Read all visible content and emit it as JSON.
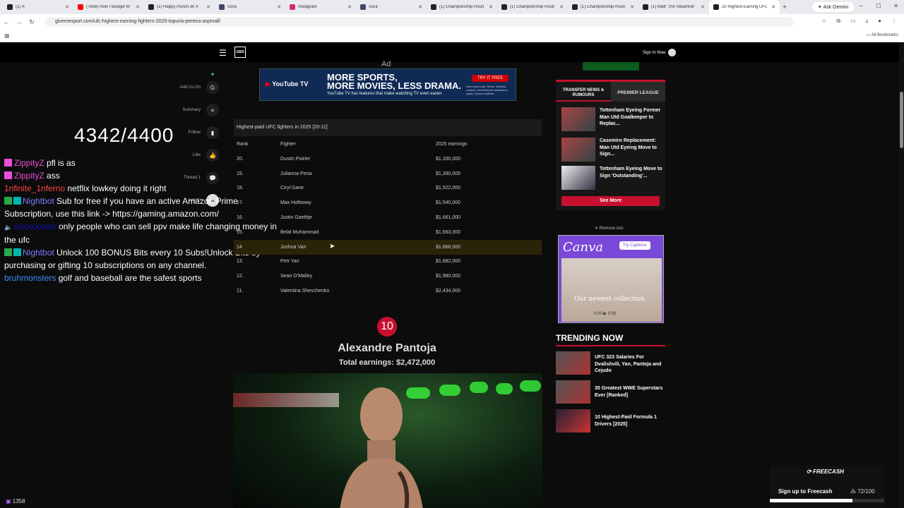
{
  "browser": {
    "tabs": [
      {
        "title": "(1) X"
      },
      {
        "title": "(7608) How I Budget M"
      },
      {
        "title": "(1) Happy Punch on X"
      },
      {
        "title": "Sora"
      },
      {
        "title": "Instagram"
      },
      {
        "title": "Sora"
      },
      {
        "title": "(1) Championship Roun"
      },
      {
        "title": "(1) Championship Roun"
      },
      {
        "title": "(1) Championship Roun"
      },
      {
        "title": "(1) Matt 'The Steamroll"
      },
      {
        "title": "20 Highest-Earning UFC"
      }
    ],
    "new_tab": "+",
    "ask_gemini": "Ask Gemini",
    "url": "givemesport.com/ufc-highest-earning-fighters-2025-topuria-pereira-aspinall/",
    "all_bookmarks": "All Bookmarks"
  },
  "site": {
    "logo": "GMS",
    "sign_in": "Sign In Now"
  },
  "ad_top": {
    "label": "Ad",
    "brand": "YouTube TV",
    "headline1": "MORE SPORTS,",
    "headline2": "MORE MOVIES, LESS DRAMA.",
    "sub": "YouTube TV has features that make watching TV even easier",
    "button": "TRY IT FREE",
    "fine": "New users only. Terms, devices, content, and blackout restrictions apply. Cancel anytime."
  },
  "side_actions": [
    {
      "label": "",
      "icon": "sparkle-icon"
    },
    {
      "label": "Add Us On",
      "icon": "google-icon"
    },
    {
      "label": "Summary",
      "icon": "summary-icon"
    },
    {
      "label": "Follow",
      "icon": "bookmark-icon"
    },
    {
      "label": "Like",
      "icon": "thumbs-up-icon"
    },
    {
      "label": "Thread",
      "count": "1",
      "icon": "thread-icon"
    },
    {
      "label": "Log In",
      "icon": "user-icon"
    }
  ],
  "overlay": {
    "count": "4342/4400",
    "viewers": "1358"
  },
  "chat": [
    {
      "user": "ZippityZ",
      "msg": "pfl is as",
      "color": "#e94fd7"
    },
    {
      "user": "ZippityZ",
      "msg": "ass",
      "color": "#e94fd7"
    },
    {
      "user": "1nfinite_1nferno",
      "msg": "netflix lowkey doing it right",
      "color": "#ff4444"
    },
    {
      "user": "Nightbot",
      "msg": "Sub for free if you have an active Amazon Prime Subscription, use this link -> https://gaming.amazon.com/",
      "color": "#7a7aff"
    },
    {
      "user": "",
      "msg": "only people who can sell ppv make life changing money in the ufc",
      "color": "#1414c8"
    },
    {
      "user": "Nightbot",
      "msg": "Unlock 100 BONUS Bits every 10 Subs!Unlock Bits by purchasing or gifting 10 subscriptions on any channel.",
      "color": "#7a7aff"
    },
    {
      "user": "bruhmonsters",
      "msg": "golf and baseball are the safest sports",
      "color": "#3d8bff"
    }
  ],
  "table": {
    "caption": "Highest-paid UFC fighters in 2025 [20-11]",
    "headers": [
      "Rank",
      "Fighter",
      "2025 earnings"
    ],
    "rows": [
      [
        "20.",
        "Dustin Poirier",
        "$1,330,000"
      ],
      [
        "19.",
        "Julianna Pena",
        "$1,390,000"
      ],
      [
        "18.",
        "Ciryl Gane",
        "$1,522,000"
      ],
      [
        "17.",
        "Max Holloway",
        "$1,540,000"
      ],
      [
        "16.",
        "Justin Gaethje",
        "$1,661,000"
      ],
      [
        "15.",
        "Belal Muhammad",
        "$1,663,000"
      ],
      [
        "14",
        "Joshua Van",
        "$1,668,000"
      ],
      [
        "13.",
        "Petr Yan",
        "$1,682,000"
      ],
      [
        "12.",
        "Sean O'Malley",
        "$1,980,000"
      ],
      [
        "11.",
        "Valentina Shevchenko",
        "$2,434,000"
      ]
    ]
  },
  "feature": {
    "rank": "10",
    "name": "Alexandre Pantoja",
    "earnings": "Total earnings: $2,472,000"
  },
  "transfer_widget": {
    "tab1": "TRANSFER NEWS & RUMOURS",
    "tab2": "PREMIER LEAGUE",
    "items": [
      "Tottenham Eyeing Former Man Utd Goalkeeper to Replac...",
      "Casemiro Replacement: Man Utd Eyeing Move to Sign...",
      "Tottenham Eyeing Move to Sign 'Outstanding'..."
    ],
    "see_more": "See More"
  },
  "ad_side": {
    "remove": "Remove Ads",
    "brand": "Canva",
    "button": "Try Captions",
    "caption": "Our newest collection",
    "time": "0:00"
  },
  "trending": {
    "title": "TRENDING NOW",
    "items": [
      "UFC 323 Salaries For Dvalishvili, Yan, Pantoja and Cejudo",
      "35 Greatest WWE Superstars Ever [Ranked]",
      "10 Highest-Paid Formula 1 Drivers [2025]"
    ]
  },
  "freecash": {
    "brand": "FREECASH",
    "cta": "Sign up to Freecash",
    "progress": "72/100",
    "progress_value": 72,
    "progress_max": 100
  }
}
